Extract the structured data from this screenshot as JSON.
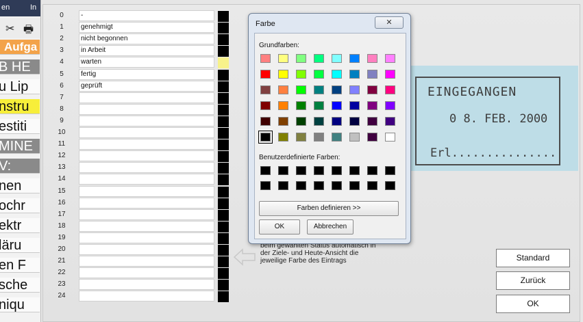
{
  "left_strip": {
    "menu": [
      "en",
      "In"
    ],
    "nav_items": [
      {
        "text": "Aufga",
        "style": "orange"
      },
      {
        "text": "B HE",
        "style": "dark"
      },
      {
        "text": "u Lip",
        "style": "plain"
      },
      {
        "text": "nstru",
        "style": "yellow"
      },
      {
        "text": "estiti",
        "style": "plain"
      },
      {
        "text": "MINE",
        "style": "dark"
      },
      {
        "text": "V:",
        "style": "dark"
      },
      {
        "text": "nen",
        "style": "plain"
      },
      {
        "text": "ochr",
        "style": "plain"
      },
      {
        "text": "ektr",
        "style": "plain"
      },
      {
        "text": "läru",
        "style": "plain"
      },
      {
        "text": "en F",
        "style": "plain"
      },
      {
        "text": "sche",
        "style": "plain"
      },
      {
        "text": "niqu",
        "style": "plain"
      }
    ]
  },
  "status_table": {
    "rows": [
      {
        "num": "0",
        "label": "-",
        "color": "#000000"
      },
      {
        "num": "1",
        "label": "genehmigt",
        "color": "#000000"
      },
      {
        "num": "2",
        "label": "nicht begonnen",
        "color": "#000000"
      },
      {
        "num": "3",
        "label": "in Arbeit",
        "color": "#000000"
      },
      {
        "num": "4",
        "label": "warten",
        "color": "#f7f28b"
      },
      {
        "num": "5",
        "label": "fertig",
        "color": "#000000"
      },
      {
        "num": "6",
        "label": "geprüft",
        "color": "#000000"
      },
      {
        "num": "7",
        "label": "",
        "color": "#000000"
      },
      {
        "num": "8",
        "label": "",
        "color": "#000000"
      },
      {
        "num": "9",
        "label": "",
        "color": "#000000"
      },
      {
        "num": "10",
        "label": "",
        "color": "#000000"
      },
      {
        "num": "11",
        "label": "",
        "color": "#000000"
      },
      {
        "num": "12",
        "label": "",
        "color": "#000000"
      },
      {
        "num": "13",
        "label": "",
        "color": "#000000"
      },
      {
        "num": "14",
        "label": "",
        "color": "#000000"
      },
      {
        "num": "15",
        "label": "",
        "color": "#000000"
      },
      {
        "num": "16",
        "label": "",
        "color": "#000000"
      },
      {
        "num": "17",
        "label": "",
        "color": "#000000"
      },
      {
        "num": "18",
        "label": "",
        "color": "#000000"
      },
      {
        "num": "19",
        "label": "",
        "color": "#000000"
      },
      {
        "num": "20",
        "label": "",
        "color": "#000000"
      },
      {
        "num": "21",
        "label": "",
        "color": "#000000"
      },
      {
        "num": "22",
        "label": "",
        "color": "#000000"
      },
      {
        "num": "23",
        "label": "",
        "color": "#000000"
      },
      {
        "num": "24",
        "label": "",
        "color": "#000000"
      }
    ]
  },
  "stamp": {
    "title": "EINGEGANGEN",
    "date": "0 8. FEB. 2000",
    "erl": "Erl..............."
  },
  "help_text": "beim gewählten Status automatisch in der Ziele- und Heute-Ansicht die jeweilige Farbe des Eintrags",
  "buttons": {
    "standard": "Standard",
    "back": "Zurück",
    "ok": "OK"
  },
  "color_dialog": {
    "title": "Farbe",
    "close_glyph": "✕",
    "basic_label": "Grundfarben:",
    "custom_label": "Benutzerdefinierte Farben:",
    "define_label": "Farben definieren >>",
    "ok_label": "OK",
    "cancel_label": "Abbrechen",
    "basic_colors": [
      [
        "#ff8080",
        "#ffff80",
        "#80ff80",
        "#00ff80",
        "#80ffff",
        "#0080ff",
        "#ff80c0",
        "#ff80ff"
      ],
      [
        "#ff0000",
        "#ffff00",
        "#80ff00",
        "#00ff40",
        "#00ffff",
        "#0080c0",
        "#8080c0",
        "#ff00ff"
      ],
      [
        "#804040",
        "#ff8040",
        "#00ff00",
        "#008080",
        "#004080",
        "#8080ff",
        "#800040",
        "#ff0080"
      ],
      [
        "#800000",
        "#ff8000",
        "#008000",
        "#008040",
        "#0000ff",
        "#0000a0",
        "#800080",
        "#8000ff"
      ],
      [
        "#400000",
        "#804000",
        "#004000",
        "#004040",
        "#000080",
        "#000040",
        "#400040",
        "#400080"
      ],
      [
        "#000000",
        "#808000",
        "#808040",
        "#808080",
        "#408080",
        "#c0c0c0",
        "#400040",
        "#ffffff"
      ]
    ],
    "selected_color": "#000000",
    "custom_colors": [
      [
        "#000000",
        "#000000",
        "#000000",
        "#000000",
        "#000000",
        "#000000",
        "#000000",
        "#000000"
      ],
      [
        "#000000",
        "#000000",
        "#000000",
        "#000000",
        "#000000",
        "#000000",
        "#000000",
        "#000000"
      ]
    ]
  }
}
